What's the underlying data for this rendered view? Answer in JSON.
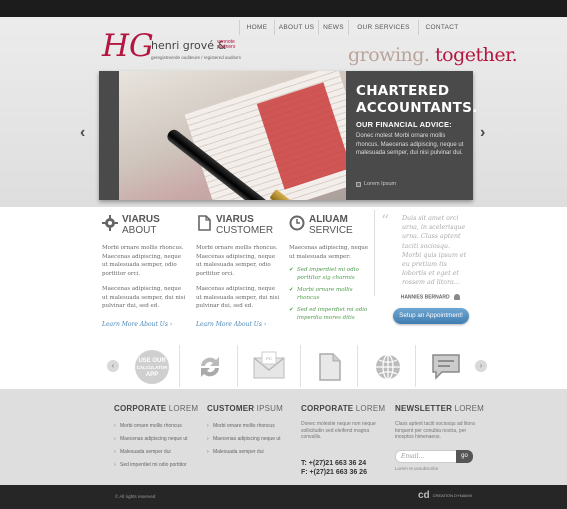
{
  "nav": [
    "HOME",
    "ABOUT US",
    "NEWS",
    "OUR SERVICES",
    "CONTACT"
  ],
  "logo": {
    "mark": "HG",
    "name": "henri grové &",
    "partners": "vennote partners",
    "sub": "geregistreerde ouditeure / registered auditors"
  },
  "tagline": {
    "part1": "growing.",
    "part2": "together."
  },
  "slider": {
    "title": "CHARTERED ACCOUNTANTS.",
    "subtitle": "OUR FINANCIAL ADVICE:",
    "text": "Donec molest Morbi ornare mollis rhoncus. Maecenas adipiscing, neque ut malesuada semper, dui nisi pulvinar dui.",
    "link": "Lorem Ipsum",
    "prev": "‹",
    "next": "›"
  },
  "columns": [
    {
      "title": "VIARUS",
      "title2": "ABOUT",
      "icon": "gear-icon",
      "p1": "Morbi ornare mollis rhoncus. Maecenas adipiscing, neque ut malesuada semper, odio porttitor orci.",
      "p2": "Maecenas adipiscing, neque ut malesuada semper, dui nisi pulvinar dui, sed ed.",
      "link": "Learn More About Us"
    },
    {
      "title": "VIARUS",
      "title2": "CUSTOMER",
      "icon": "document-icon",
      "p1": "Morbi ornare mollis rhoncus. Maecenas adipiscing, neque ut malesuada semper, odio porttitor orci.",
      "p2": "Maecenas adipiscing, neque ut malesuada semper, dui nisi pulvinar dui, sed ed.",
      "link": "Learn More About Us"
    },
    {
      "title": "ALIUAM",
      "title2": "SERVICE",
      "icon": "clock-icon",
      "p1": "Maecenas adipiscing, neque ut malesuada semper:",
      "items": [
        "Sed imperdiet mi odio porttitor sig charmis",
        "Morbi ornare mollis rhoncus",
        "Sed ed imperdiet mi odio imperdia mores ditis"
      ]
    }
  ],
  "quote": {
    "mark": "“",
    "text": "Duis sit amet orci urna, in scelerisque urna. Class aptent taciti sociosqu. Morbi quis ipsum et eu pretium tis lobortis et eget et rossem ad litora...",
    "author": "HANNIES BERNARD"
  },
  "appointment": "Setup an Appointment!",
  "icon_strip": [
    "use-our-calculator-app-icon",
    "refresh-arrows-icon",
    "envelope-icon",
    "page-icon",
    "globe-icon",
    "chat-icon"
  ],
  "icon_strip_badge": "USE OUR CALCULATOR APP",
  "footer": {
    "col1": {
      "title": "CORPORATE",
      "title2": "LOREM",
      "items": [
        "Morbi ornare mollis rhoncus",
        "Maecenas adipiscing neque ut",
        "Malesuada semper dui",
        "Sed imperdiet mi odio porttitor"
      ]
    },
    "col2": {
      "title": "CUSTOMER",
      "title2": "IPSUM",
      "items": [
        "Morbi ornare mollis rhoncus",
        "Maecenas adipiscing neque ut",
        "Malesuada semper dui"
      ]
    },
    "col3": {
      "title": "CORPORATE",
      "title2": "LOREM",
      "text": "Donec molestie neque non neque sollicitudin sed eleifend magna convallis.",
      "tel": "T: +(27)21 663 36 24",
      "fax": "F: +(27)21 663 36 26"
    },
    "col4": {
      "title": "NEWSLETTER",
      "title2": "LOREM",
      "text": "Class aptent taciti sociosqu ad litora torquent per conubia nostra, per inceptos himenaeos.",
      "placeholder": "Email...",
      "go": "go",
      "unsub": "Lorem et unsubscribe"
    }
  },
  "copyright": "© All rights reserved",
  "credit": {
    "logo": "cd",
    "text": "CREATION DYNAMIX"
  }
}
